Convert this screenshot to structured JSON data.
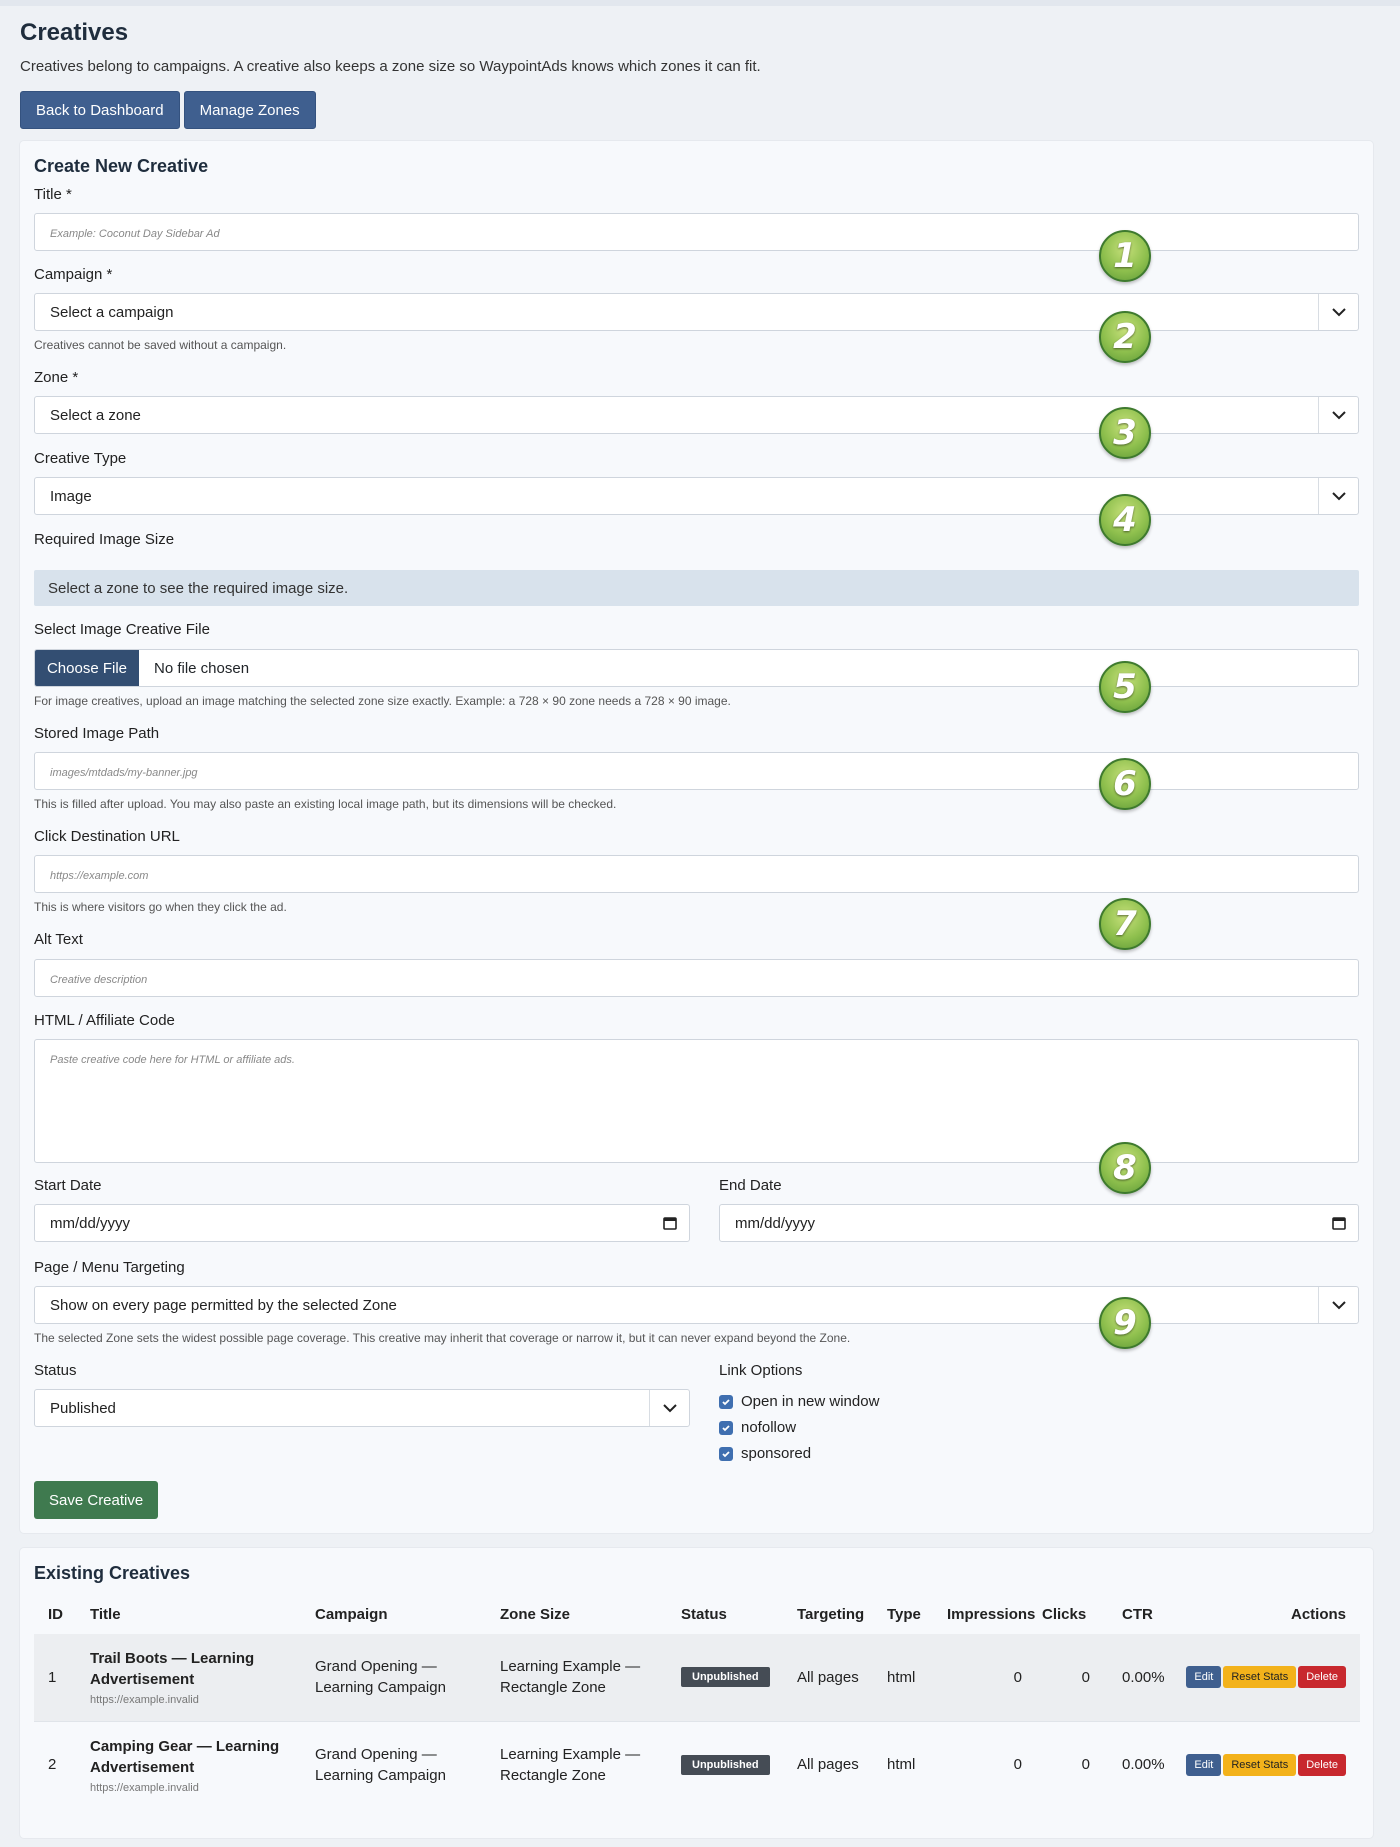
{
  "header": {
    "title": "Creatives",
    "intro": "Creatives belong to campaigns. A creative also keeps a zone size so WaypointAds knows which zones it can fit.",
    "back_button": "Back to Dashboard",
    "zones_button": "Manage Zones"
  },
  "form": {
    "heading": "Create New Creative",
    "title_label": "Title *",
    "title_placeholder": "Example: Coconut Day Sidebar Ad",
    "campaign_label": "Campaign *",
    "campaign_value": "Select a campaign",
    "campaign_help": "Creatives cannot be saved without a campaign.",
    "zone_label": "Zone *",
    "zone_value": "Select a zone",
    "type_label": "Creative Type",
    "type_value": "Image",
    "size_label": "Required Image Size",
    "size_info": "Select a zone to see the required image size.",
    "file_label": "Select Image Creative File",
    "file_button": "Choose File",
    "file_status": "No file chosen",
    "file_help": "For image creatives, upload an image matching the selected zone size exactly. Example: a 728 × 90 zone needs a 728 × 90 image.",
    "path_label": "Stored Image Path",
    "path_placeholder": "images/mtdads/my-banner.jpg",
    "path_help": "This is filled after upload. You may also paste an existing local image path, but its dimensions will be checked.",
    "url_label": "Click Destination URL",
    "url_placeholder": "https://example.com",
    "url_help": "This is where visitors go when they click the ad.",
    "alt_label": "Alt Text",
    "alt_placeholder": "Creative description",
    "html_label": "HTML / Affiliate Code",
    "html_placeholder": "Paste creative code here for HTML or affiliate ads.",
    "start_label": "Start Date",
    "start_value": "mm/dd/yyyy",
    "end_label": "End Date",
    "end_value": "mm/dd/yyyy",
    "targeting_label": "Page / Menu Targeting",
    "targeting_value": "Show on every page permitted by the selected Zone",
    "targeting_help": "The selected Zone sets the widest possible page coverage. This creative may inherit that coverage or narrow it, but it can never expand beyond the Zone.",
    "status_label": "Status",
    "status_value": "Published",
    "link_label": "Link Options",
    "link_options": [
      "Open in new window",
      "nofollow",
      "sponsored"
    ],
    "save_button": "Save Creative"
  },
  "markers": [
    "1",
    "2",
    "3",
    "4",
    "5",
    "6",
    "7",
    "8",
    "9"
  ],
  "table": {
    "heading": "Existing Creatives",
    "columns": [
      "ID",
      "Title",
      "Campaign",
      "Zone Size",
      "Status",
      "Targeting",
      "Type",
      "Impressions",
      "Clicks",
      "CTR",
      "Actions"
    ],
    "rows": [
      {
        "id": "1",
        "title_line1": "Trail Boots — Learning",
        "title_line2": "Advertisement",
        "url": "https://example.invalid",
        "campaign_line1": "Grand Opening —",
        "campaign_line2": "Learning Campaign",
        "zone_line1": "Learning Example —",
        "zone_line2": "Rectangle Zone",
        "status": "Unpublished",
        "targeting": "All pages",
        "type": "html",
        "impressions": "0",
        "clicks": "0",
        "ctr": "0.00%"
      },
      {
        "id": "2",
        "title_line1": "Camping Gear — Learning",
        "title_line2": "Advertisement",
        "url": "https://example.invalid",
        "campaign_line1": "Grand Opening —",
        "campaign_line2": "Learning Campaign",
        "zone_line1": "Learning Example —",
        "zone_line2": "Rectangle Zone",
        "status": "Unpublished",
        "targeting": "All pages",
        "type": "html",
        "impressions": "0",
        "clicks": "0",
        "ctr": "0.00%"
      }
    ],
    "actions": {
      "edit": "Edit",
      "reset": "Reset Stats",
      "delete": "Delete"
    }
  },
  "colors": {
    "primary": "#3f5f8f",
    "success": "#3f7a4f",
    "warning": "#f3b21b",
    "danger": "#c8282e",
    "marker": "#8fc04e"
  }
}
